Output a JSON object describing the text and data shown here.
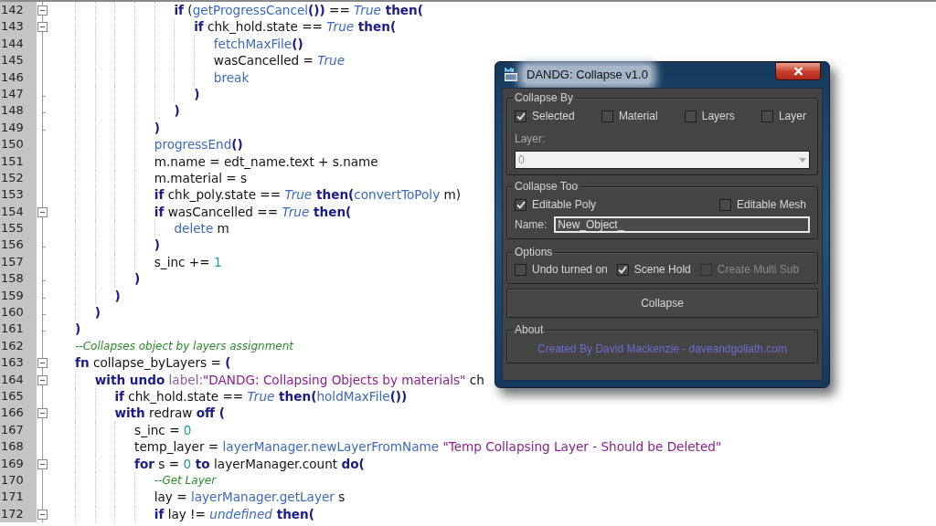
{
  "editor": {
    "lines": [
      {
        "children": [
          {
            "children": [
              {
                "children": [
                  {
                    "children": [
                      {
                        "children": [
                          {
                            "number": "142",
                            "kind": "fold-start",
                            "tokens": [
                              {
                                "kind": "kw",
                                "text": "if"
                              },
                              {
                                "kind": "plain",
                                "text": " ("
                              },
                              {
                                "kind": "fn",
                                "text": "getProgressCancel"
                              },
                              {
                                "kind": "kw",
                                "text": "())"
                              },
                              {
                                "kind": "plain",
                                "text": " == "
                              },
                              {
                                "kind": "bool",
                                "text": "True"
                              },
                              {
                                "kind": "kw",
                                "text": " then("
                              }
                            ],
                            "children": [
                              {
                                "number": "143",
                                "kind": "fold-start",
                                "tokens": [
                                  {
                                    "kind": "kw",
                                    "text": "if"
                                  },
                                  {
                                    "kind": "plain",
                                    "text": " chk_hold.state == "
                                  },
                                  {
                                    "kind": "bool",
                                    "text": "True"
                                  },
                                  {
                                    "kind": "kw",
                                    "text": " then("
                                  }
                                ],
                                "children": [
                                  {
                                    "number": "144",
                                    "kind": "fold-body",
                                    "tokens": [
                                      {
                                        "kind": "fn",
                                        "text": "fetchMaxFile"
                                      },
                                      {
                                        "kind": "kw",
                                        "text": "()"
                                      }
                                    ]
                                  },
                                  {
                                    "number": "145",
                                    "kind": "fold-body",
                                    "tokens": [
                                      {
                                        "kind": "plain",
                                        "text": "wasCancelled = "
                                      },
                                      {
                                        "kind": "bool",
                                        "text": "True"
                                      }
                                    ]
                                  },
                                  {
                                    "number": "146",
                                    "kind": "fold-body",
                                    "tokens": [
                                      {
                                        "kind": "fn",
                                        "text": "break"
                                      }
                                    ]
                                  }
                                ]
                              },
                              {
                                "number": "147",
                                "kind": "fold-end",
                                "tokens": [
                                  {
                                    "kind": "kw",
                                    "text": ")"
                                  }
                                ]
                              }
                            ]
                          },
                          {
                            "number": "148",
                            "kind": "fold-end",
                            "tokens": [
                              {
                                "kind": "kw",
                                "text": ")"
                              }
                            ]
                          }
                        ]
                      },
                      {
                        "number": "149",
                        "kind": "fold-end",
                        "tokens": [
                          {
                            "kind": "kw",
                            "text": ")"
                          }
                        ]
                      },
                      {
                        "number": "150",
                        "kind": "fold-body",
                        "tokens": [
                          {
                            "kind": "fn",
                            "text": "progressEnd"
                          },
                          {
                            "kind": "kw",
                            "text": "()"
                          }
                        ]
                      },
                      {
                        "number": "151",
                        "kind": "fold-body",
                        "tokens": [
                          {
                            "kind": "plain",
                            "text": "m.name = edt_name.text + s.name"
                          }
                        ]
                      },
                      {
                        "number": "152",
                        "kind": "fold-body",
                        "tokens": [
                          {
                            "kind": "plain",
                            "text": "m.material = s"
                          }
                        ]
                      },
                      {
                        "number": "153",
                        "kind": "fold-body",
                        "tokens": [
                          {
                            "kind": "kw",
                            "text": "if"
                          },
                          {
                            "kind": "plain",
                            "text": " chk_poly.state == "
                          },
                          {
                            "kind": "bool",
                            "text": "True"
                          },
                          {
                            "kind": "kw",
                            "text": " then("
                          },
                          {
                            "kind": "fn",
                            "text": "convertToPoly"
                          },
                          {
                            "kind": "plain",
                            "text": " m)"
                          }
                        ]
                      },
                      {
                        "number": "154",
                        "kind": "fold-start",
                        "tokens": [
                          {
                            "kind": "kw",
                            "text": "if"
                          },
                          {
                            "kind": "plain",
                            "text": " wasCancelled == "
                          },
                          {
                            "kind": "bool",
                            "text": "True"
                          },
                          {
                            "kind": "kw",
                            "text": " then("
                          }
                        ],
                        "children": [
                          {
                            "number": "155",
                            "kind": "fold-body",
                            "tokens": [
                              {
                                "kind": "fn",
                                "text": "delete"
                              },
                              {
                                "kind": "plain",
                                "text": " m"
                              }
                            ]
                          }
                        ]
                      },
                      {
                        "number": "156",
                        "kind": "fold-end",
                        "tokens": [
                          {
                            "kind": "kw",
                            "text": ")"
                          }
                        ]
                      },
                      {
                        "number": "157",
                        "kind": "fold-body",
                        "tokens": [
                          {
                            "kind": "plain",
                            "text": "s_inc += "
                          },
                          {
                            "kind": "num",
                            "text": "1"
                          }
                        ]
                      }
                    ]
                  },
                  {
                    "number": "158",
                    "kind": "fold-end",
                    "tokens": [
                      {
                        "kind": "kw",
                        "text": ")"
                      }
                    ]
                  }
                ]
              },
              {
                "number": "159",
                "kind": "fold-end",
                "tokens": [
                  {
                    "kind": "kw",
                    "text": ")"
                  }
                ]
              }
            ]
          },
          {
            "number": "160",
            "kind": "fold-end",
            "tokens": [
              {
                "kind": "kw",
                "text": ")"
              }
            ]
          }
        ]
      },
      {
        "number": "161",
        "kind": "fold-end",
        "tokens": [
          {
            "kind": "kw",
            "text": ")"
          }
        ]
      },
      {
        "number": "162",
        "kind": "fold-body",
        "tokens": [
          {
            "kind": "comment",
            "text": "--Collapses object by layers assignment"
          }
        ]
      },
      {
        "number": "163",
        "kind": "fold-start",
        "tokens": [
          {
            "kind": "kw",
            "text": "fn"
          },
          {
            "kind": "plain",
            "text": " collapse_byLayers = "
          },
          {
            "kind": "kw",
            "text": "("
          }
        ],
        "children": [
          {
            "number": "164",
            "kind": "fold-start",
            "tokens": [
              {
                "kind": "kw",
                "text": "with undo"
              },
              {
                "kind": "label",
                "text": " label:"
              },
              {
                "kind": "str",
                "text": "\"DANDG: Collapsing Objects by materials\""
              },
              {
                "kind": "plain",
                "text": " ch"
              }
            ],
            "children": [
              {
                "number": "165",
                "kind": "fold-body",
                "tokens": [
                  {
                    "kind": "kw",
                    "text": "if"
                  },
                  {
                    "kind": "plain",
                    "text": " chk_hold.state == "
                  },
                  {
                    "kind": "bool",
                    "text": "True"
                  },
                  {
                    "kind": "kw",
                    "text": " then("
                  },
                  {
                    "kind": "fn",
                    "text": "holdMaxFile"
                  },
                  {
                    "kind": "kw",
                    "text": "())"
                  }
                ]
              },
              {
                "number": "166",
                "kind": "fold-start",
                "tokens": [
                  {
                    "kind": "kw",
                    "text": "with"
                  },
                  {
                    "kind": "plain",
                    "text": " redraw "
                  },
                  {
                    "kind": "kw",
                    "text": "off ("
                  }
                ],
                "children": [
                  {
                    "number": "167",
                    "kind": "fold-body",
                    "tokens": [
                      {
                        "kind": "plain",
                        "text": "s_inc = "
                      },
                      {
                        "kind": "num",
                        "text": "0"
                      }
                    ]
                  },
                  {
                    "number": "168",
                    "kind": "fold-body",
                    "tokens": [
                      {
                        "kind": "plain",
                        "text": "temp_layer = "
                      },
                      {
                        "kind": "fn",
                        "text": "layerManager.newLayerFromName"
                      },
                      {
                        "kind": "str",
                        "text": " \"Temp Collapsing Layer - Should be Deleted\""
                      }
                    ]
                  },
                  {
                    "number": "169",
                    "kind": "fold-start",
                    "tokens": [
                      {
                        "kind": "kw",
                        "text": "for"
                      },
                      {
                        "kind": "plain",
                        "text": " s = "
                      },
                      {
                        "kind": "num",
                        "text": "0"
                      },
                      {
                        "kind": "kw",
                        "text": " to"
                      },
                      {
                        "kind": "plain",
                        "text": " layerManager.count "
                      },
                      {
                        "kind": "kw",
                        "text": "do("
                      }
                    ],
                    "children": [
                      {
                        "number": "170",
                        "kind": "fold-body",
                        "tokens": [
                          {
                            "kind": "comment",
                            "text": "--Get Layer"
                          }
                        ]
                      },
                      {
                        "number": "171",
                        "kind": "fold-body",
                        "tokens": [
                          {
                            "kind": "plain",
                            "text": "lay = "
                          },
                          {
                            "kind": "fn",
                            "text": "layerManager.getLayer"
                          },
                          {
                            "kind": "plain",
                            "text": " s"
                          }
                        ]
                      },
                      {
                        "number": "172",
                        "kind": "fold-start",
                        "tokens": [
                          {
                            "kind": "kw",
                            "text": "if"
                          },
                          {
                            "kind": "plain",
                            "text": " lay != "
                          },
                          {
                            "kind": "bool",
                            "text": "undefined"
                          },
                          {
                            "kind": "kw",
                            "text": " then("
                          }
                        ]
                      }
                    ]
                  }
                ]
              }
            ]
          }
        ]
      }
    ]
  },
  "dialog": {
    "title": "DANDG: Collapse v1.0",
    "collapse_by": {
      "label": "Collapse By",
      "options": [
        {
          "label": "Selected",
          "checked": true
        },
        {
          "label": "Material",
          "checked": false
        },
        {
          "label": "Layers",
          "checked": false
        },
        {
          "label": "Layer",
          "checked": false
        }
      ],
      "layer_label": "Layer:",
      "layer_value": "0",
      "layer_disabled": true
    },
    "collapse_too": {
      "label": "Collapse Too",
      "options": [
        {
          "label": "Editable Poly",
          "checked": true
        },
        {
          "label": "Editable Mesh",
          "checked": false
        }
      ],
      "name_label": "Name:",
      "name_value": "New_Object_"
    },
    "options": {
      "label": "Options",
      "options": [
        {
          "label": "Undo turned on",
          "checked": false,
          "disabled": false
        },
        {
          "label": "Scene Hold",
          "checked": true,
          "disabled": false
        },
        {
          "label": "Create Multi Sub",
          "checked": false,
          "disabled": true
        }
      ]
    },
    "collapse_button": "Collapse",
    "about": {
      "label": "About",
      "text": "Created By David Mackenzie - daveandgoliath.com"
    }
  }
}
